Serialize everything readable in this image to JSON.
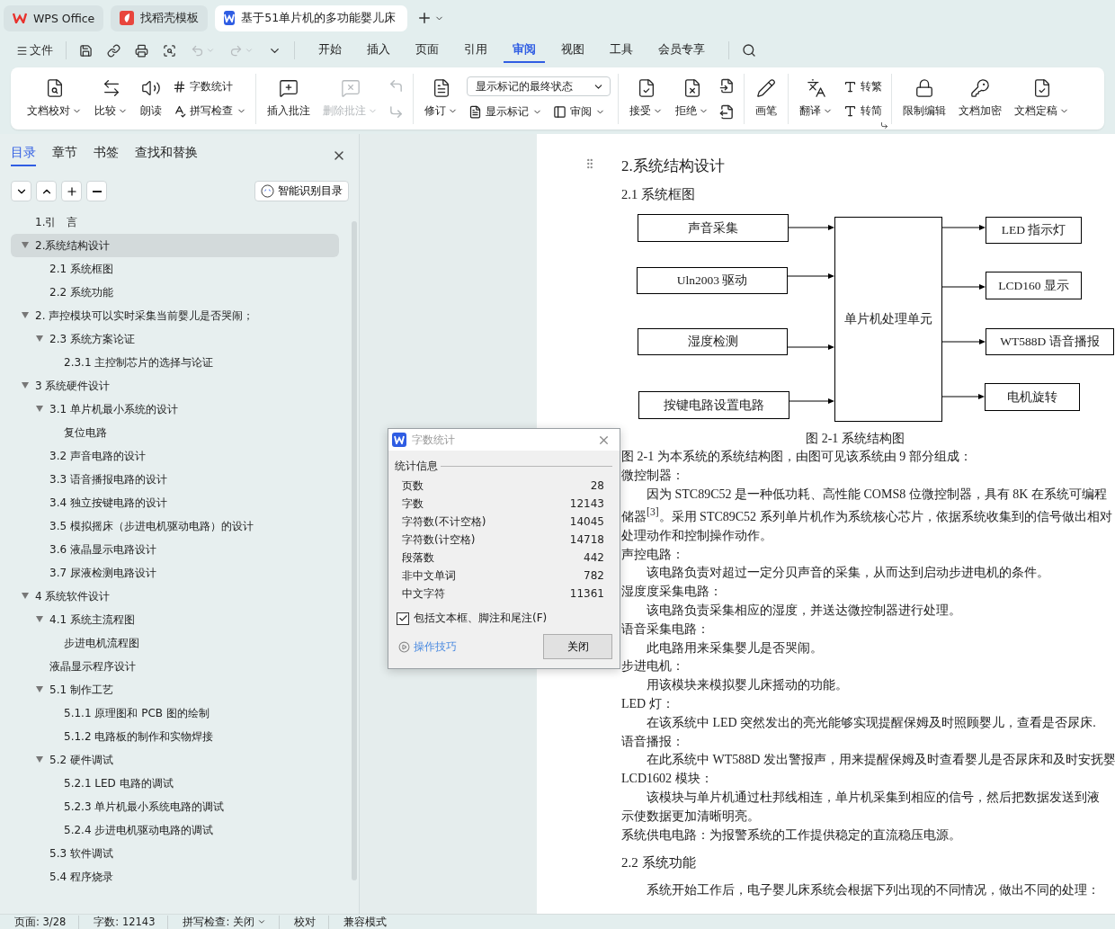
{
  "title_tabs": [
    {
      "label": "WPS Office",
      "selected": false,
      "kind": "home"
    },
    {
      "label": "找稻壳模板",
      "selected": false,
      "kind": "template"
    },
    {
      "label": "基于51单片机的多功能婴儿床",
      "selected": true,
      "kind": "document"
    }
  ],
  "menu": {
    "file": "文件",
    "tabs": [
      {
        "label": "开始",
        "selected": false
      },
      {
        "label": "插入",
        "selected": false
      },
      {
        "label": "页面",
        "selected": false
      },
      {
        "label": "引用",
        "selected": false
      },
      {
        "label": "审阅",
        "selected": true
      },
      {
        "label": "视图",
        "selected": false
      },
      {
        "label": "工具",
        "selected": false
      },
      {
        "label": "会员专享",
        "selected": false
      }
    ]
  },
  "ribbon": {
    "groups": [
      {
        "items": [
          {
            "kind": "big",
            "label": "文档校对",
            "dropdown": true,
            "disabled": false
          },
          {
            "kind": "big",
            "label": "比较",
            "dropdown": true,
            "disabled": false
          },
          {
            "kind": "big",
            "label": "朗读",
            "dropdown": false,
            "disabled": false
          },
          {
            "kind": "stack",
            "rows": [
              [
                {
                  "kind": "small",
                  "label": "字数统计",
                  "dropdown": false,
                  "disabled": false
                }
              ],
              [
                {
                  "kind": "small",
                  "label": "拼写检查",
                  "dropdown": true,
                  "disabled": false
                }
              ]
            ]
          }
        ]
      },
      {
        "items": [
          {
            "kind": "big",
            "label": "插入批注",
            "dropdown": false,
            "disabled": false
          },
          {
            "kind": "big",
            "label": "删除批注",
            "dropdown": true,
            "disabled": true
          },
          {
            "kind": "stack",
            "rows": [
              [
                {
                  "kind": "icon",
                  "disabled": true
                }
              ],
              [
                {
                  "kind": "icon",
                  "disabled": true
                }
              ]
            ]
          }
        ]
      },
      {
        "items": [
          {
            "kind": "big",
            "label": "修订",
            "dropdown": true,
            "disabled": false
          },
          {
            "kind": "stack",
            "rows": [
              [
                {
                  "kind": "select",
                  "value": "显示标记的最终状态"
                }
              ],
              [
                {
                  "kind": "small",
                  "label": "显示标记",
                  "dropdown": true,
                  "disabled": false
                },
                {
                  "kind": "small",
                  "label": "审阅",
                  "dropdown": true,
                  "disabled": false
                }
              ]
            ]
          }
        ]
      },
      {
        "items": [
          {
            "kind": "big",
            "label": "接受",
            "dropdown": true,
            "disabled": false
          },
          {
            "kind": "big",
            "label": "拒绝",
            "dropdown": true,
            "disabled": false
          },
          {
            "kind": "stack",
            "rows": [
              [
                {
                  "kind": "icon",
                  "disabled": false
                }
              ],
              [
                {
                  "kind": "icon",
                  "disabled": false
                }
              ]
            ]
          }
        ]
      },
      {
        "items": [
          {
            "kind": "big",
            "label": "画笔",
            "dropdown": false,
            "disabled": false
          }
        ]
      },
      {
        "launcher": true,
        "items": [
          {
            "kind": "big",
            "label": "翻译",
            "dropdown": true,
            "disabled": false
          },
          {
            "kind": "stack",
            "rows": [
              [
                {
                  "kind": "small",
                  "label": "转繁",
                  "dropdown": false,
                  "disabled": false
                }
              ],
              [
                {
                  "kind": "small",
                  "label": "转简",
                  "dropdown": false,
                  "disabled": false
                }
              ]
            ]
          }
        ]
      },
      {
        "items": [
          {
            "kind": "big",
            "label": "限制编辑",
            "dropdown": false,
            "disabled": false
          },
          {
            "kind": "big",
            "label": "文档加密",
            "dropdown": false,
            "disabled": false
          },
          {
            "kind": "big",
            "label": "文档定稿",
            "dropdown": true,
            "disabled": false
          }
        ]
      }
    ]
  },
  "sidebar": {
    "tabs": [
      {
        "label": "目录",
        "selected": true
      },
      {
        "label": "章节",
        "selected": false
      },
      {
        "label": "书签",
        "selected": false
      },
      {
        "label": "查找和替换",
        "selected": false
      }
    ],
    "smart_button": "智能识别目录",
    "toc": [
      {
        "label": "1.引　言",
        "selected": false
      },
      {
        "label": "2.系统结构设计",
        "selected": true,
        "expanded": true,
        "children": [
          {
            "label": "2.1  系统框图",
            "selected": false
          },
          {
            "label": "2.2  系统功能",
            "selected": false
          }
        ]
      },
      {
        "label": "2. 声控模块可以实时采集当前婴儿是否哭闹；",
        "selected": false,
        "expanded": true,
        "children": [
          {
            "label": "2.3  系统方案论证",
            "selected": false,
            "expanded": true,
            "children": [
              {
                "label": "2.3.1  主控制芯片的选择与论证",
                "selected": false
              }
            ]
          }
        ]
      },
      {
        "label": "3 系统硬件设计",
        "selected": false,
        "expanded": true,
        "children": [
          {
            "label": "3.1  单片机最小系统的设计",
            "selected": false,
            "expanded": true,
            "children": [
              {
                "label": "复位电路",
                "selected": false
              }
            ]
          },
          {
            "label": "3.2  声音电路的设计",
            "selected": false
          },
          {
            "label": "3.3 语音播报电路的设计",
            "selected": false
          },
          {
            "label": "3.4  独立按键电路的设计",
            "selected": false
          },
          {
            "label": "3.5  模拟摇床（步进电机驱动电路）的设计",
            "selected": false
          },
          {
            "label": "3.6  液晶显示电路设计",
            "selected": false
          },
          {
            "label": "3.7 尿液检测电路设计",
            "selected": false
          }
        ]
      },
      {
        "label": "4 系统软件设计",
        "selected": false,
        "expanded": true,
        "children": [
          {
            "label": "4.1  系统主流程图",
            "selected": false,
            "expanded": true,
            "children": [
              {
                "label": "步进电机流程图",
                "selected": false
              }
            ]
          },
          {
            "label": "液晶显示程序设计",
            "selected": false
          },
          {
            "label": "5.1  制作工艺",
            "selected": false,
            "expanded": true,
            "children": [
              {
                "label": "5.1.1 原理图和 PCB 图的绘制",
                "selected": false
              },
              {
                "label": "5.1.2  电路板的制作和实物焊接",
                "selected": false
              }
            ]
          },
          {
            "label": "5.2  硬件调试",
            "selected": false,
            "expanded": true,
            "children": [
              {
                "label": "5.2.1 LED 电路的调试",
                "selected": false
              },
              {
                "label": "5.2.3 单片机最小系统电路的调试",
                "selected": false
              },
              {
                "label": "5.2.4 步进电机驱动电路的调试",
                "selected": false
              }
            ]
          },
          {
            "label": "5.3  软件调试",
            "selected": false
          },
          {
            "label": "5.4  程序烧录",
            "selected": false
          }
        ]
      }
    ]
  },
  "document": {
    "title": "2.系统结构设计",
    "subtitle": "2.1  系统框图",
    "diagram": {
      "inputs": [
        "声音采集",
        "Uln2003 驱动",
        "湿度检测",
        "按键电路设置电路"
      ],
      "processor": "单片机处理单元",
      "outputs": [
        "LED 指示灯",
        "LCD160 显示",
        "WT588D 语音播报",
        "电机旋转"
      ]
    },
    "caption": "图 2-1  系统结构图",
    "lines": [
      {
        "kind": "plain",
        "text": "图 2-1 为本系统的系统结构图，由图可见该系统由 9 部分组成："
      },
      {
        "kind": "plain",
        "text": "微控制器："
      },
      {
        "kind": "indent",
        "text": "因为 STC89C52 是一种低功耗、高性能 COMS8 位微控制器，具有 8K 在系统可编程"
      },
      {
        "kind": "plain",
        "text": "储器$^{[3]}$。采用 STC89C52 系列单片机作为系统核心芯片，依据系统收集到的信号做出相对"
      },
      {
        "kind": "plain",
        "text": "处理动作和控制操作动作。"
      },
      {
        "kind": "plain",
        "text": "声控电路："
      },
      {
        "kind": "indent",
        "text": "该电路负责对超过一定分贝声音的采集，从而达到启动步进电机的条件。"
      },
      {
        "kind": "plain",
        "text": "湿度度采集电路："
      },
      {
        "kind": "indent",
        "text": "该电路负责采集相应的湿度，并送达微控制器进行处理。"
      },
      {
        "kind": "plain",
        "text": "语音采集电路："
      },
      {
        "kind": "indent",
        "text": "此电路用来采集婴儿是否哭闹。"
      },
      {
        "kind": "plain",
        "text": "步进电机："
      },
      {
        "kind": "indent",
        "text": "用该模块来模拟婴儿床摇动的功能。"
      },
      {
        "kind": "plain",
        "text": "LED 灯："
      },
      {
        "kind": "indent",
        "text": "在该系统中 LED 突然发出的亮光能够实现提醒保姆及时照顾婴儿，查看是否尿床."
      },
      {
        "kind": "plain",
        "text": "语音播报："
      },
      {
        "kind": "indent",
        "text": "在此系统中 WT588D 发出警报声，用来提醒保姆及时查看婴儿是否尿床和及时安抚婴"
      },
      {
        "kind": "plain",
        "text": "LCD1602 模块："
      },
      {
        "kind": "indent",
        "text": "该模块与单片机通过杜邦线相连，单片机采集到相应的信号，然后把数据发送到液"
      },
      {
        "kind": "plain",
        "text": "示使数据更加清晰明亮。"
      },
      {
        "kind": "plain",
        "text": "系统供电电路：为报警系统的工作提供稳定的直流稳压电源。"
      },
      {
        "kind": "heading",
        "text": "2.2  系统功能"
      },
      {
        "kind": "indent",
        "text": "系统开始工作后，电子婴儿床系统会根据下列出现的不同情况，做出不同的处理："
      }
    ]
  },
  "dialog": {
    "title": "字数统计",
    "group": "统计信息",
    "stats": [
      {
        "label": "页数",
        "value": "28"
      },
      {
        "label": "字数",
        "value": "12143"
      },
      {
        "label": "字符数(不计空格)",
        "value": "14045"
      },
      {
        "label": "字符数(计空格)",
        "value": "14718"
      },
      {
        "label": "段落数",
        "value": "442"
      },
      {
        "label": "非中文单词",
        "value": "782"
      },
      {
        "label": "中文字符",
        "value": "11361"
      }
    ],
    "checkbox": {
      "label": "包括文本框、脚注和尾注(F)",
      "checked": true
    },
    "tips_link": "操作技巧",
    "close_button": "关闭"
  },
  "status_bar": [
    {
      "kind": "text",
      "text": "页面: 3/28"
    },
    {
      "kind": "text",
      "text": "字数: 12143"
    },
    {
      "kind": "dropdown",
      "text": "拼写检查: 关闭"
    },
    {
      "kind": "text",
      "text": "校对"
    },
    {
      "kind": "text",
      "text": "兼容模式"
    }
  ]
}
